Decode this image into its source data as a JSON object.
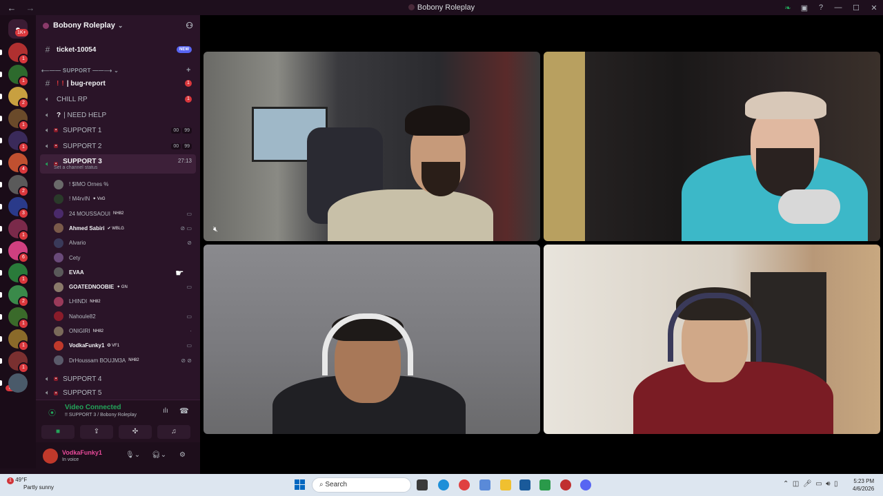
{
  "window": {
    "title": "Bobony Roleplay"
  },
  "rail": {
    "home_badge": "1K+",
    "new_label": "NEW",
    "servers": [
      {
        "color": "#b03030",
        "badge": "1"
      },
      {
        "color": "#2d6a2d",
        "badge": "1"
      },
      {
        "color": "#c8a040",
        "badge": "2"
      },
      {
        "color": "#6a4a2a",
        "badge": "1"
      },
      {
        "color": "#3a2a5a",
        "badge": "1"
      },
      {
        "color": "#c05030",
        "badge": "4"
      },
      {
        "color": "#5a5a5a",
        "badge": "2"
      },
      {
        "color": "#2a3a8a",
        "badge": "3"
      },
      {
        "color": "#7a2a4a",
        "badge": "1"
      },
      {
        "color": "#d04080",
        "badge": "6"
      },
      {
        "color": "#2a7a3a",
        "badge": "1"
      },
      {
        "color": "#3a8a4a",
        "badge": "2"
      },
      {
        "color": "#3a6a2a",
        "badge": "1"
      },
      {
        "color": "#8a6a2a",
        "badge": "1"
      },
      {
        "color": "#7a3030",
        "badge": "1"
      },
      {
        "color": "#4a5a6a",
        "badge": ""
      }
    ]
  },
  "server": {
    "name": "Bobony Roleplay"
  },
  "channels": {
    "ticket": {
      "name": "ticket-10054",
      "badge": "NEW"
    },
    "support_category": "⟵—— SUPPORT ——⟶",
    "bug_report": {
      "prefix": "!",
      "name": "| bug-report",
      "badge": "1"
    },
    "chill": {
      "name": "CHILL RP",
      "badge": "1"
    },
    "need_help": {
      "prefix": "?",
      "name": "| NEED HELP"
    },
    "support1": {
      "name": "SUPPORT 1",
      "counts": [
        "00",
        "99"
      ]
    },
    "support2": {
      "name": "SUPPORT 2",
      "counts": [
        "00",
        "99"
      ]
    },
    "support3": {
      "name": "SUPPORT 3",
      "status": "Set a channel status",
      "timer": "27:13"
    },
    "support4": {
      "name": "SUPPORT 4"
    },
    "support5": {
      "name": "SUPPORT 5"
    }
  },
  "voice_users": [
    {
      "name": "! $IMO Ornes %",
      "color": "#6a6a6a",
      "tag": "",
      "icons": ""
    },
    {
      "name": "! M4rvIN",
      "color": "#2a3a2a",
      "tag": "✦ VxG",
      "icons": ""
    },
    {
      "name": "24 MOUSSAOUI",
      "color": "#4a2a6a",
      "tag": "NH82",
      "icons": "▭"
    },
    {
      "name": "Ahmed Sabiri",
      "color": "#7a5a4a",
      "tag": "✔ WBLG",
      "icons": "⊘ ▭"
    },
    {
      "name": "Alvario",
      "color": "#3a3a5a",
      "tag": "",
      "icons": "⊘"
    },
    {
      "name": "Cety",
      "color": "#6a4a7a",
      "tag": "",
      "icons": ""
    },
    {
      "name": "EVAA",
      "color": "#5a5a5a",
      "tag": "",
      "icons": ""
    },
    {
      "name": "GOATEDNOOBIE",
      "color": "#8a7a6a",
      "tag": "✦ GN",
      "icons": "▭"
    },
    {
      "name": "LHINDI",
      "color": "#9a3a5a",
      "tag": "NH82",
      "icons": ""
    },
    {
      "name": "Nahoule82",
      "color": "#8a1c2a",
      "tag": "",
      "icons": "▭"
    },
    {
      "name": "ONIGIRI",
      "color": "#7a6a5a",
      "tag": "NH82",
      "icons": "·"
    },
    {
      "name": "VodkaFunky1",
      "color": "#c0392b",
      "tag": "✪ VF1",
      "icons": "▭"
    },
    {
      "name": "DrHoussam BOUJM3A",
      "color": "#5a5a6a",
      "tag": "NH82",
      "icons": "⊘ ⊘"
    }
  ],
  "voice_panel": {
    "title": "Video Connected",
    "subtitle": "!! SUPPORT 3 / Bobony Roleplay"
  },
  "user": {
    "name": "VodkaFunky1",
    "status": "In voice"
  },
  "taskbar": {
    "weather_temp": "49°F",
    "weather_desc": "Partly sunny",
    "weather_badge": "1",
    "search_placeholder": "Search",
    "time": "5:23 PM",
    "date": "4/6/2026"
  }
}
